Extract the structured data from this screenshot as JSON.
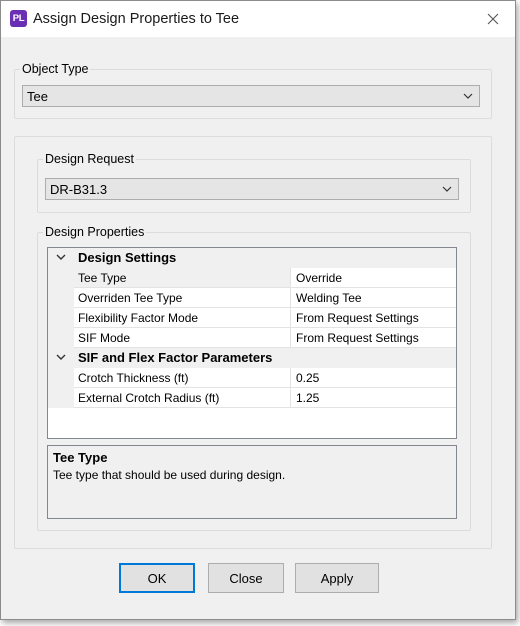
{
  "window": {
    "app_icon_text": "PL",
    "title": "Assign Design Properties to Tee"
  },
  "object_type": {
    "legend": "Object Type",
    "value": "Tee"
  },
  "design_request": {
    "legend": "Design Request",
    "value": "DR-B31.3"
  },
  "design_properties": {
    "legend": "Design Properties",
    "categories": [
      {
        "title": "Design Settings",
        "rows": [
          {
            "name": "Tee Type",
            "value": "Override"
          },
          {
            "name": "Overriden Tee Type",
            "value": "Welding Tee"
          },
          {
            "name": "Flexibility Factor Mode",
            "value": "From Request Settings"
          },
          {
            "name": "SIF Mode",
            "value": "From Request Settings"
          }
        ]
      },
      {
        "title": "SIF and Flex Factor Parameters",
        "rows": [
          {
            "name": "Crotch Thickness (ft)",
            "value": "0.25"
          },
          {
            "name": "External Crotch Radius (ft)",
            "value": "1.25"
          }
        ]
      }
    ],
    "description": {
      "title": "Tee Type",
      "text": "Tee type that should be used during design."
    }
  },
  "buttons": {
    "ok": "OK",
    "close": "Close",
    "apply": "Apply"
  }
}
